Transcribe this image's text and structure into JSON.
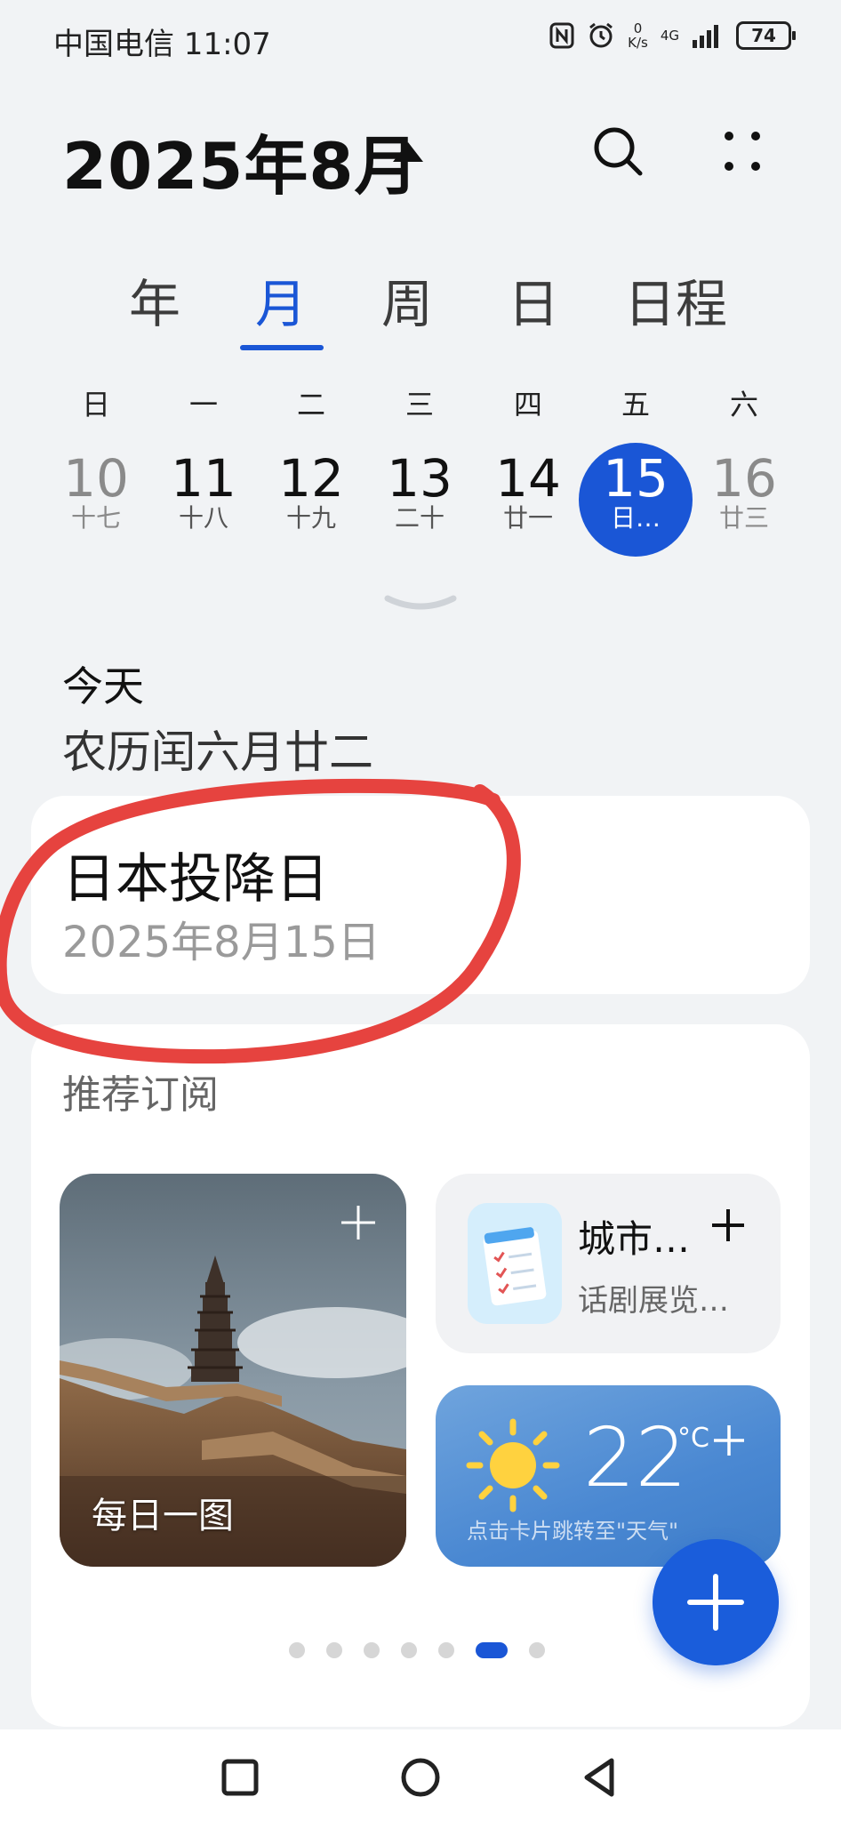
{
  "status_bar": {
    "carrier_time": "中国电信 11:07",
    "net_speed_value": "0",
    "net_speed_unit": "K/s",
    "network": "4G",
    "battery": "74",
    "icons": [
      "nfc-icon",
      "alarm-icon",
      "signal-icon",
      "battery-icon"
    ]
  },
  "header": {
    "month_title": "2025年8月",
    "icons": [
      "caret-up-icon",
      "search-icon",
      "more-icon"
    ]
  },
  "tabs": [
    {
      "label": "年",
      "active": false
    },
    {
      "label": "月",
      "active": true
    },
    {
      "label": "周",
      "active": false
    },
    {
      "label": "日",
      "active": false
    },
    {
      "label": "日程",
      "active": false
    }
  ],
  "week": {
    "weekdays": [
      "日",
      "一",
      "二",
      "三",
      "四",
      "五",
      "六"
    ],
    "days": [
      {
        "num": "10",
        "lunar": "十七"
      },
      {
        "num": "11",
        "lunar": "十八"
      },
      {
        "num": "12",
        "lunar": "十九"
      },
      {
        "num": "13",
        "lunar": "二十"
      },
      {
        "num": "14",
        "lunar": "廿一"
      },
      {
        "num": "15",
        "lunar": "日…",
        "selected": true
      },
      {
        "num": "16",
        "lunar": "廿三"
      }
    ]
  },
  "today": {
    "label": "今天",
    "lunar_date": "农历闰六月廿二"
  },
  "holiday": {
    "name": "日本投降日",
    "date": "2025年8月15日"
  },
  "recommended": {
    "title": "推荐订阅",
    "photo_card": {
      "label": "每日一图"
    },
    "city_card": {
      "title": "城市…",
      "subtitle": "话剧展览…"
    },
    "weather_card": {
      "temp": "22",
      "unit": "°C",
      "hint": "点击卡片跳转至\"天气\""
    },
    "pager": {
      "count": 7,
      "active_index": 5
    }
  },
  "colors": {
    "accent": "#1a56d6",
    "background": "#f1f3f5",
    "annotation": "#e53935"
  }
}
